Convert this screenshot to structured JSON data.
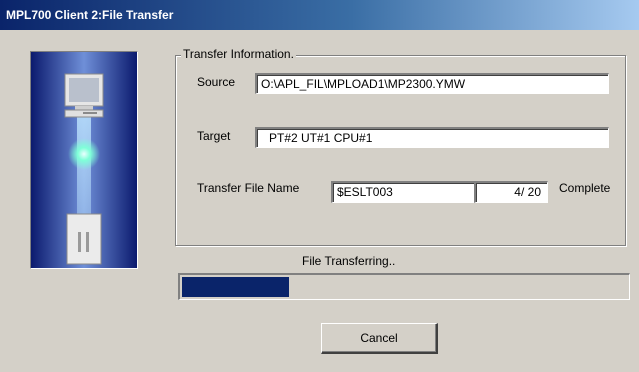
{
  "window": {
    "title": "MPL700 Client  2:File Transfer"
  },
  "transfer_info": {
    "group_label": "Transfer Information.",
    "source_label": "Source",
    "source_value": "O:\\APL_FIL\\MPLOAD1\\MP2300.YMW",
    "target_label": "Target",
    "target_value": "PT#2  UT#1  CPU#1",
    "file_name_label": "Transfer File Name",
    "file_name_value": "$ESLT003",
    "counter_value": "4/ 20",
    "complete_label": "Complete"
  },
  "progress": {
    "status_text": "File Transferring..",
    "fraction": 0.24,
    "fill_color": "#0a246a"
  },
  "buttons": {
    "cancel_label": "Cancel"
  },
  "icons": {
    "illustration": "computer-transfer-illustration"
  }
}
